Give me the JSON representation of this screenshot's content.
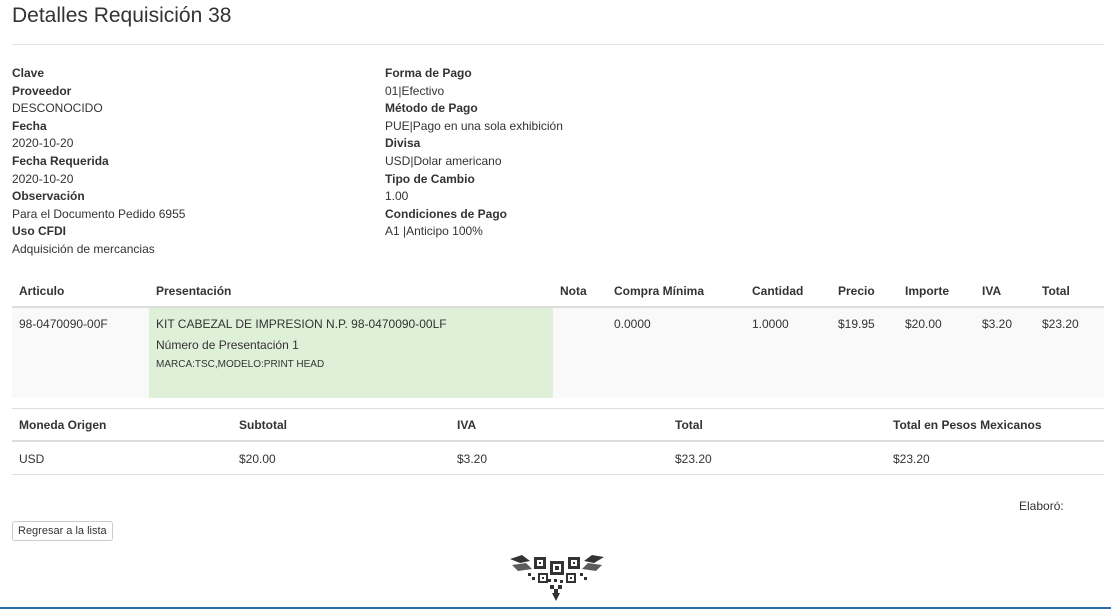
{
  "page": {
    "title": "Detalles Requisición 38"
  },
  "details_left": [
    {
      "label": "Clave",
      "value": ""
    },
    {
      "label": "Proveedor",
      "value": "DESCONOCIDO"
    },
    {
      "label": "Fecha",
      "value": "2020-10-20"
    },
    {
      "label": "Fecha Requerida",
      "value": "2020-10-20"
    },
    {
      "label": "Observación",
      "value": "Para el Documento Pedido 6955"
    },
    {
      "label": "Uso CFDI",
      "value": "Adquisición de mercancias"
    }
  ],
  "details_right": [
    {
      "label": "Forma de Pago",
      "value": "01|Efectivo"
    },
    {
      "label": "Método de Pago",
      "value": "PUE|Pago en una sola exhibición"
    },
    {
      "label": "Divisa",
      "value": "USD|Dolar americano"
    },
    {
      "label": "Tipo de Cambio",
      "value": "1.00"
    },
    {
      "label": "Condiciones de Pago",
      "value": "A1 |Anticipo 100%"
    }
  ],
  "items_table": {
    "headers": [
      "Articulo",
      "Presentación",
      "Nota",
      "Compra Mínima",
      "Cantidad",
      "Precio",
      "Importe",
      "IVA",
      "Total"
    ],
    "rows": [
      {
        "articulo": "98-0470090-00F",
        "presentacion": {
          "name": "KIT CABEZAL DE IMPRESION N.P. 98-0470090-00LF",
          "number": "Número de Presentación 1",
          "attrs": "MARCA:TSC,MODELO:PRINT HEAD"
        },
        "nota": "",
        "compra_minima": "0.0000",
        "cantidad": "1.0000",
        "precio": "$19.95",
        "importe": "$20.00",
        "iva": "$3.20",
        "total": "$23.20"
      }
    ],
    "highlight_color": "#dff0d8"
  },
  "totals_table": {
    "headers": [
      "Moneda Origen",
      "Subtotal",
      "IVA",
      "Total",
      "Total en Pesos Mexicanos"
    ],
    "row": [
      "USD",
      "$20.00",
      "$3.20",
      "$23.20",
      "$23.20"
    ]
  },
  "footer": {
    "elaboro_label": "Elaboró:",
    "back_button_label": "Regresar a la lista",
    "logo_icon": "qr-seal-icon"
  },
  "colors": {
    "accent": "#2b6cb0",
    "highlight": "#dff0d8",
    "text": "#333333"
  }
}
